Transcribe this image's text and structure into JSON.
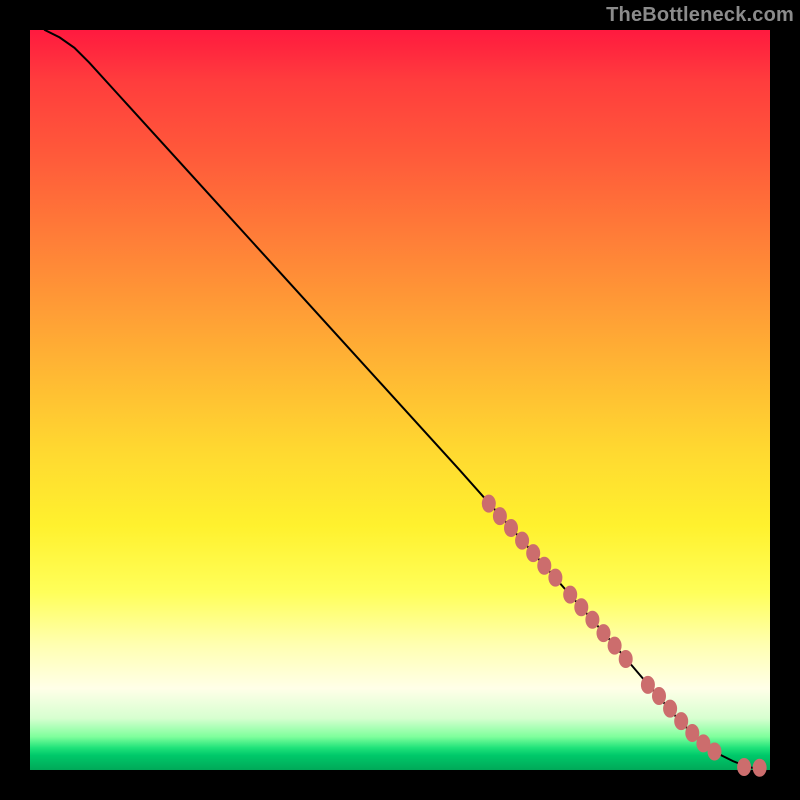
{
  "watermark_text": "TheBottleneck.com",
  "colors": {
    "curve": "#000000",
    "dot": "#cc6d6d",
    "gradient_top": "#ff1a3f",
    "gradient_bottom": "#00a858"
  },
  "chart_data": {
    "type": "line",
    "title": "",
    "xlabel": "",
    "ylabel": "",
    "xlim": [
      0,
      100
    ],
    "ylim": [
      0,
      100
    ],
    "curve": {
      "x": [
        2,
        4,
        6,
        8,
        12,
        18,
        26,
        34,
        42,
        50,
        58,
        66,
        72,
        78,
        84,
        88,
        91,
        93,
        95,
        96.5,
        97.6,
        98.6
      ],
      "y": [
        100,
        99,
        97.6,
        95.6,
        91.2,
        84.6,
        75.8,
        67.0,
        58.2,
        49.4,
        40.6,
        31.6,
        24.8,
        18.0,
        11.0,
        6.4,
        3.6,
        2.2,
        1.2,
        0.6,
        0.3,
        0.3
      ]
    },
    "points": [
      {
        "x": 62.0,
        "y": 36.0
      },
      {
        "x": 63.5,
        "y": 34.3
      },
      {
        "x": 65.0,
        "y": 32.7
      },
      {
        "x": 66.5,
        "y": 31.0
      },
      {
        "x": 68.0,
        "y": 29.3
      },
      {
        "x": 69.5,
        "y": 27.6
      },
      {
        "x": 71.0,
        "y": 26.0
      },
      {
        "x": 73.0,
        "y": 23.7
      },
      {
        "x": 74.5,
        "y": 22.0
      },
      {
        "x": 76.0,
        "y": 20.3
      },
      {
        "x": 77.5,
        "y": 18.5
      },
      {
        "x": 79.0,
        "y": 16.8
      },
      {
        "x": 80.5,
        "y": 15.0
      },
      {
        "x": 83.5,
        "y": 11.5
      },
      {
        "x": 85.0,
        "y": 10.0
      },
      {
        "x": 86.5,
        "y": 8.3
      },
      {
        "x": 88.0,
        "y": 6.6
      },
      {
        "x": 89.5,
        "y": 5.0
      },
      {
        "x": 91.0,
        "y": 3.6
      },
      {
        "x": 92.5,
        "y": 2.5
      },
      {
        "x": 96.5,
        "y": 0.4
      },
      {
        "x": 98.6,
        "y": 0.3
      }
    ]
  }
}
